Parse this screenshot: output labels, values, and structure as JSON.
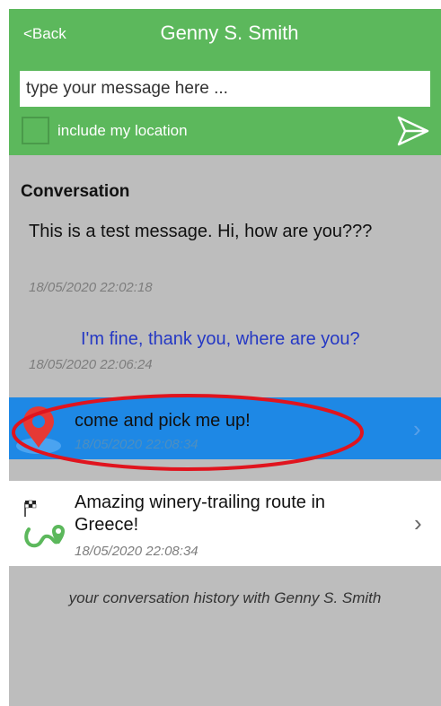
{
  "header": {
    "back_label": "<Back",
    "title": "Genny S. Smith",
    "input_placeholder": "type your message here ...",
    "location_label": "include my location",
    "send_icon": "send-icon",
    "color": "#5cb85c"
  },
  "conversation": {
    "heading": "Conversation",
    "messages": [
      {
        "text": "This is a test message. Hi, how are you???",
        "time": "18/05/2020 22:02:18"
      },
      {
        "text": "I'm fine, thank you, where are you?",
        "time": "18/05/2020 22:06:24"
      }
    ],
    "location_item": {
      "text": "come and pick me up!",
      "time": "18/05/2020 22:08:34",
      "icon": "map-pin-icon",
      "color": "#1e88e5"
    },
    "route_item": {
      "text": "Amazing winery-trailing route in Greece!",
      "time": "18/05/2020 22:08:34",
      "icon": "route-icon"
    },
    "footer": "your conversation history with Genny S. Smith"
  },
  "annotation": {
    "color": "#e0141e",
    "shape": "ellipse"
  }
}
